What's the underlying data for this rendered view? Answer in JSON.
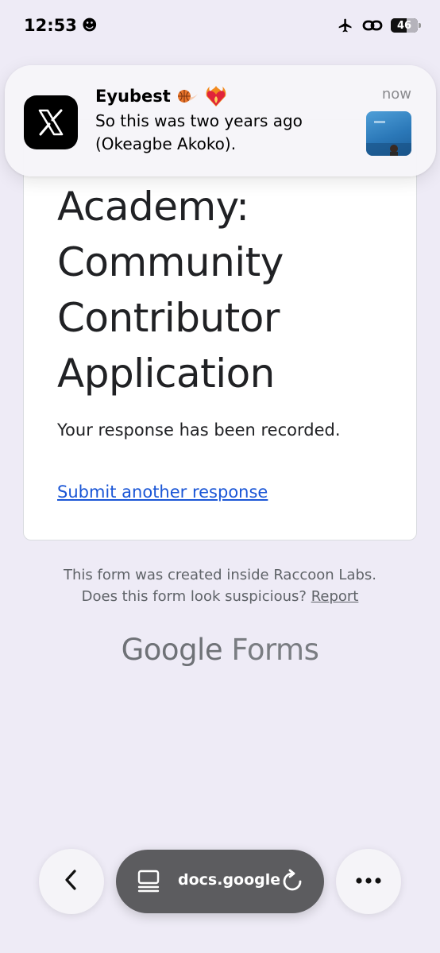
{
  "status_bar": {
    "time": "12:53",
    "smiley": "☻",
    "battery_level": "46"
  },
  "notification": {
    "app_icon": "x-logo-icon",
    "sender": "Eyubest",
    "sender_emojis": [
      "basketball-fire-icon",
      "heart-on-fire-icon"
    ],
    "message": "So this was two years ago (Okeagbe Akoko).",
    "time": "now"
  },
  "form": {
    "title": "Academy: Community Contributor Application",
    "response_message": "Your response has been recorded.",
    "submit_another": "Submit another response"
  },
  "footer": {
    "created_inside": "This form was created inside Raccoon Labs.",
    "suspicious_question": "Does this form look suspicious?",
    "report_link": "Report"
  },
  "brand": {
    "google": "Google",
    "forms": "Forms"
  },
  "toolbar": {
    "back_icon": "chevron-left-icon",
    "tabs_icon": "tabs-icon",
    "url": "docs.google.com",
    "reload_icon": "reload-icon",
    "more_icon": "more-dots-icon"
  },
  "colors": {
    "background": "#eeebf6",
    "link": "#1a56d6",
    "url_pill": "#5c5c5f"
  }
}
